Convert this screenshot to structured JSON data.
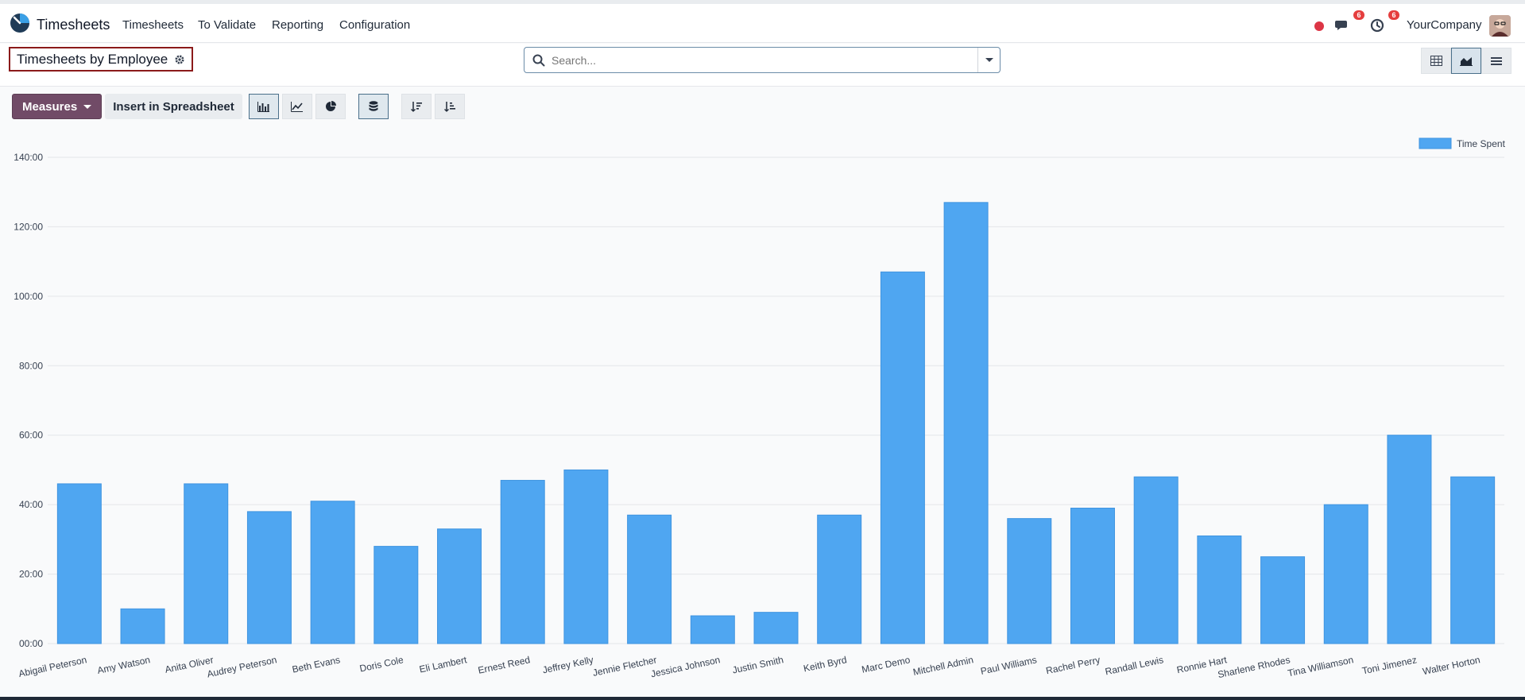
{
  "app": {
    "name": "Timesheets"
  },
  "nav": [
    "Timesheets",
    "To Validate",
    "Reporting",
    "Configuration"
  ],
  "systray": {
    "messages_count": "6",
    "activities_count": "6",
    "company": "YourCompany"
  },
  "breadcrumb": {
    "title": "Timesheets by Employee"
  },
  "search": {
    "placeholder": "Search..."
  },
  "toolbar": {
    "measures_label": "Measures",
    "spreadsheet_label": "Insert in Spreadsheet"
  },
  "colors": {
    "bar": "#4fa6f1",
    "brand": "#714b67"
  },
  "chart_data": {
    "type": "bar",
    "categories": [
      "Abigail Peterson",
      "Amy Watson",
      "Anita Oliver",
      "Audrey Peterson",
      "Beth Evans",
      "Doris Cole",
      "Eli Lambert",
      "Ernest Reed",
      "Jeffrey Kelly",
      "Jennie Fletcher",
      "Jessica Johnson",
      "Justin Smith",
      "Keith Byrd",
      "Marc Demo",
      "Mitchell Admin",
      "Paul Williams",
      "Rachel Perry",
      "Randall Lewis",
      "Ronnie Hart",
      "Sharlene Rhodes",
      "Tina Williamson",
      "Toni Jimenez",
      "Walter Horton"
    ],
    "series": [
      {
        "name": "Time Spent",
        "values": [
          46,
          10,
          46,
          38,
          41,
          28,
          33,
          47,
          50,
          37,
          8,
          9,
          37,
          107,
          127,
          36,
          39,
          48,
          31,
          25,
          40,
          60,
          48
        ]
      }
    ],
    "yticks": [
      "00:00",
      "20:00",
      "40:00",
      "60:00",
      "80:00",
      "100:00",
      "120:00",
      "140:00"
    ],
    "ylim": [
      0,
      140
    ],
    "grid": true,
    "legend": "top-right"
  }
}
